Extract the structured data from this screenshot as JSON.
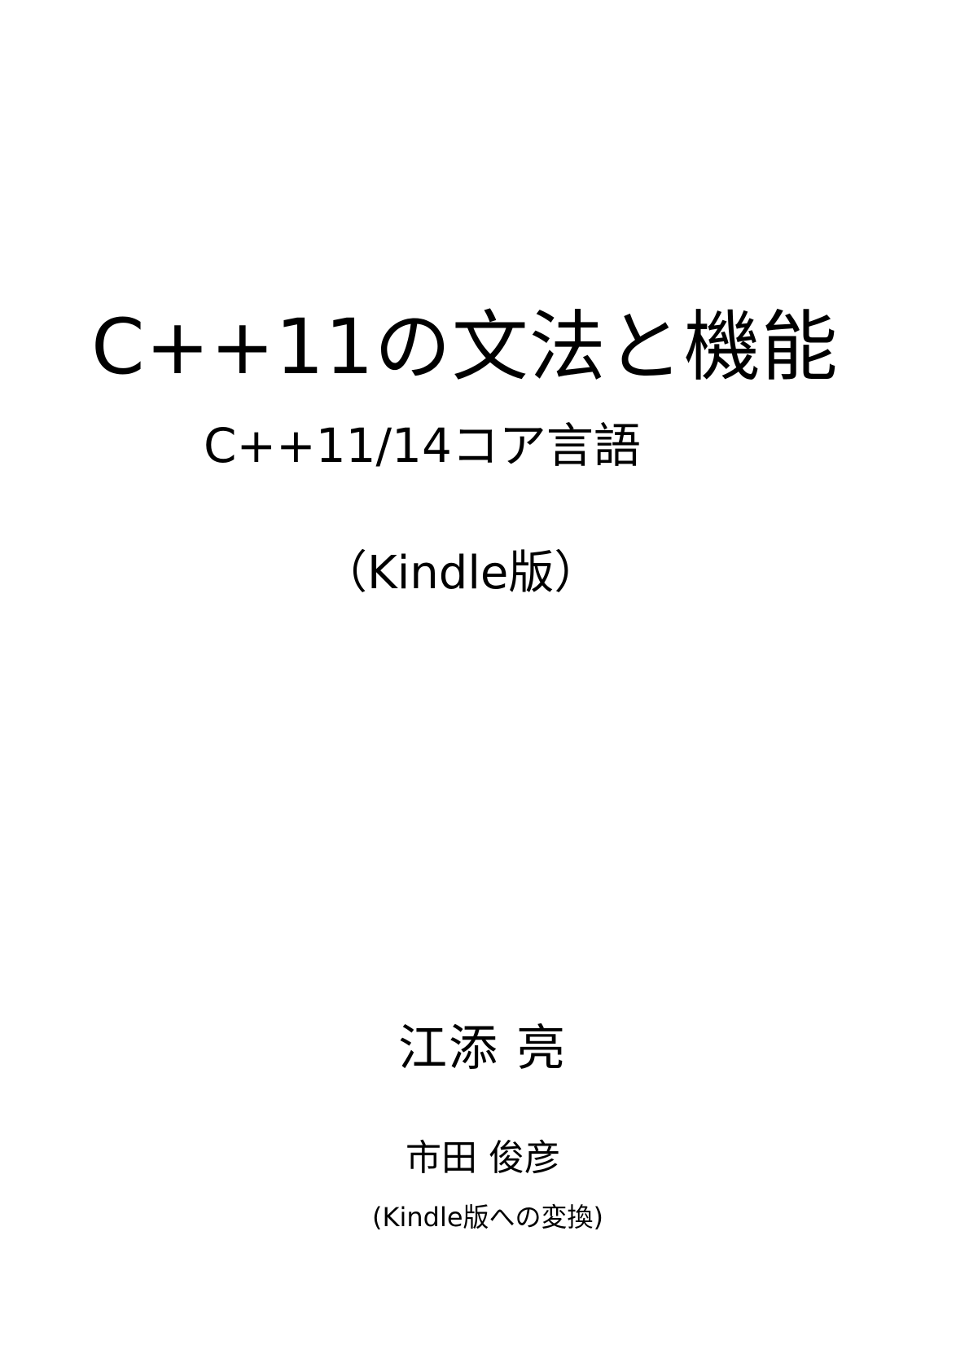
{
  "cover": {
    "title": "C++11の文法と機能",
    "subtitle": "C++11/14コア言語",
    "edition": "（Kindle版）",
    "author": "江添 亮",
    "converter": "市田 俊彦",
    "converter_note": "(Kindle版への変換)"
  }
}
